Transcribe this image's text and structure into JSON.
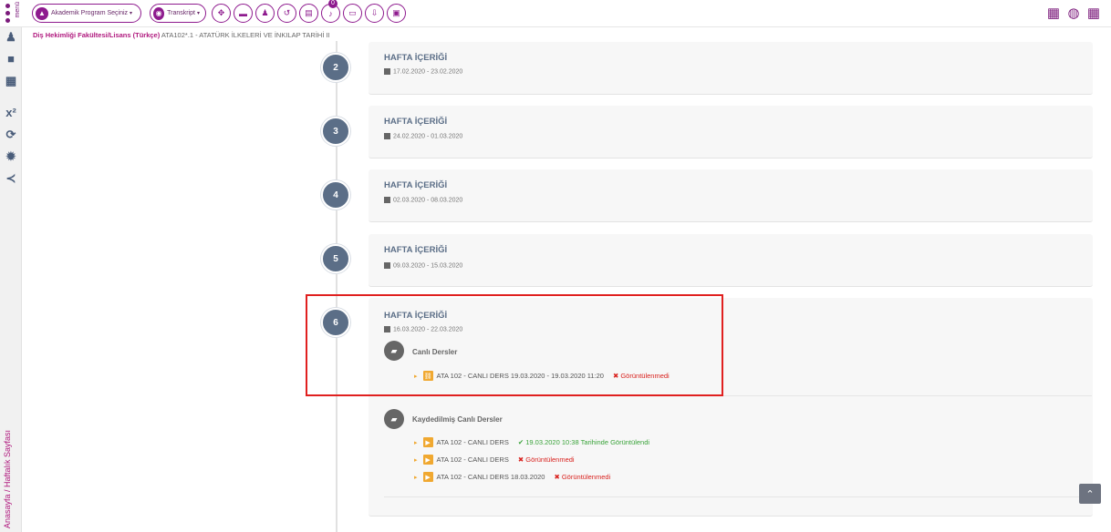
{
  "topbar": {
    "menu_label": "menü",
    "program_pill": "Akademik Program Seçiniz",
    "transkript_pill": "Transkript",
    "notification_count": "0",
    "icons": [
      "move-icon",
      "card-icon",
      "user-icon",
      "history-icon",
      "document-icon",
      "bell-icon",
      "window-icon",
      "pin-icon",
      "file-icon"
    ]
  },
  "right_icons": [
    "calendar-icon",
    "globe-icon",
    "apps-grid-icon"
  ],
  "sidebar": {
    "icons": [
      "user-icon",
      "book-icon",
      "calendar-icon",
      "superscript-icon",
      "refresh-icon",
      "gear-icon",
      "share-icon"
    ],
    "vertical_label": "Anasayfa / Haftalık Sayfası"
  },
  "breadcrumb": {
    "faculty": "Diş Hekimliği Fakültesi/Lisans (Türkçe)",
    "course": "ATA102*.1 - ATATÜRK İLKELERİ VE İNKILAP TARİHİ II"
  },
  "weeks": [
    {
      "num": "2",
      "title": "HAFTA İÇERİĞİ",
      "date": "17.02.2020 - 23.02.2020"
    },
    {
      "num": "3",
      "title": "HAFTA İÇERİĞİ",
      "date": "24.02.2020 - 01.03.2020"
    },
    {
      "num": "4",
      "title": "HAFTA İÇERİĞİ",
      "date": "02.03.2020 - 08.03.2020"
    },
    {
      "num": "5",
      "title": "HAFTA İÇERİĞİ",
      "date": "09.03.2020 - 15.03.2020"
    },
    {
      "num": "6",
      "title": "HAFTA İÇERİĞİ",
      "date": "16.03.2020 - 22.03.2020"
    }
  ],
  "live": {
    "title": "Canlı Dersler",
    "item": "ATA 102 - CANLI DERS 19.03.2020 - 19.03.2020 11:20",
    "status": "Görüntülenmedi"
  },
  "recorded": {
    "title": "Kaydedilmiş Canlı Dersler",
    "items": [
      {
        "label": "ATA 102 - CANLI DERS",
        "status": "19.03.2020 10:38 Tarihinde Görüntülendi"
      },
      {
        "label": "ATA 102 - CANLI DERS",
        "status": "Görüntülenmedi"
      },
      {
        "label": "ATA 102 - CANLI DERS 18.03.2020",
        "status": "Görüntülenmedi"
      }
    ]
  },
  "colors": {
    "accent": "#8e1a8e",
    "timeline_badge": "#5b6e87",
    "highlight": "#e0201f",
    "viewed": "#3aa33a",
    "not_viewed": "#d9231f"
  }
}
